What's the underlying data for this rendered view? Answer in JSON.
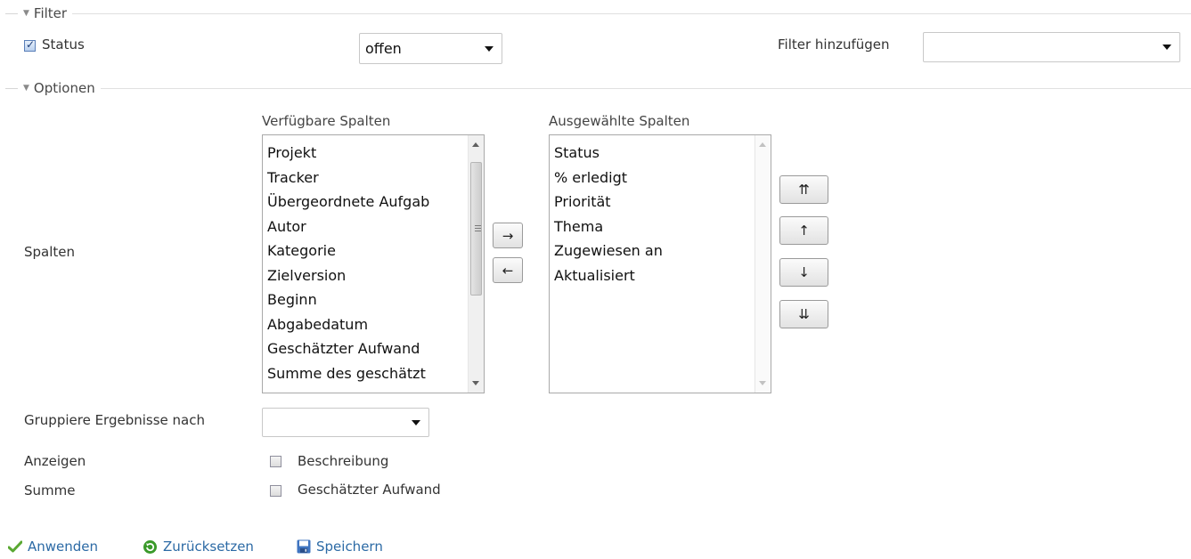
{
  "filter": {
    "legend": "Filter",
    "status_label": "Status",
    "status_checked": true,
    "status_value": "offen",
    "add_filter_label": "Filter hinzufügen",
    "add_filter_value": ""
  },
  "options": {
    "legend": "Optionen",
    "columns_label": "Spalten",
    "available_header": "Verfügbare Spalten",
    "selected_header": "Ausgewählte Spalten",
    "available_columns": [
      "Projekt",
      "Tracker",
      "Übergeordnete Aufgab",
      "Autor",
      "Kategorie",
      "Zielversion",
      "Beginn",
      "Abgabedatum",
      "Geschätzter Aufwand",
      "Summe des geschätzt"
    ],
    "selected_columns": [
      "Status",
      "% erledigt",
      "Priorität",
      "Thema",
      "Zugewiesen an",
      "Aktualisiert"
    ],
    "move_right": "→",
    "move_left": "←",
    "move_top": "⇈",
    "move_up": "↑",
    "move_down": "↓",
    "move_bottom": "⇊",
    "group_by_label": "Gruppiere Ergebnisse nach",
    "group_by_value": "",
    "show_label": "Anzeigen",
    "show_option": "Beschreibung",
    "show_checked": false,
    "total_label": "Summe",
    "total_option": "Geschätzter Aufwand",
    "total_checked": false
  },
  "actions": {
    "apply": "Anwenden",
    "reset": "Zurücksetzen",
    "save": "Speichern"
  },
  "colors": {
    "link": "#2c6aa5",
    "apply_icon": "#5aa832",
    "reset_icon": "#3a9a2a",
    "save_icon": "#3f74c0"
  }
}
